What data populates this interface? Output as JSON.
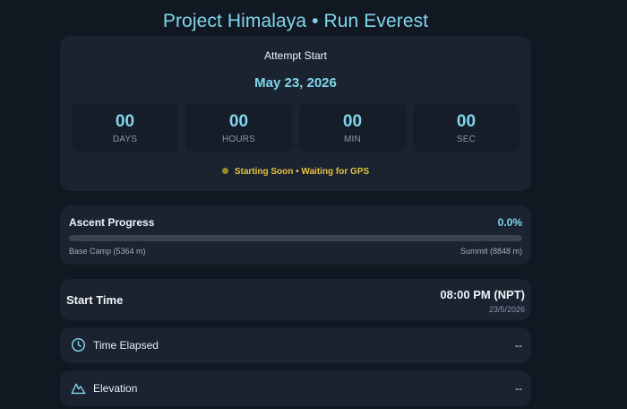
{
  "header": {
    "title": "Project Himalaya • Run Everest"
  },
  "countdown": {
    "label": "Attempt Start",
    "date": "May 23, 2026",
    "units": [
      {
        "value": "00",
        "label": "DAYS"
      },
      {
        "value": "00",
        "label": "HOURS"
      },
      {
        "value": "00",
        "label": "MIN"
      },
      {
        "value": "00",
        "label": "SEC"
      }
    ],
    "status": "Starting Soon • Waiting for GPS"
  },
  "progress": {
    "title": "Ascent Progress",
    "percent_text": "0.0%",
    "percent": 0.0,
    "start_label": "Base Camp (5364 m)",
    "end_label": "Summit (8848 m)"
  },
  "start_time": {
    "label": "Start Time",
    "time": "08:00 PM (NPT)",
    "date": "23/5/2026"
  },
  "stats": {
    "elapsed": {
      "label": "Time Elapsed",
      "value": "--",
      "icon": "clock-icon"
    },
    "elevation": {
      "label": "Elevation",
      "value": "--",
      "icon": "mountain-icon"
    }
  },
  "colors": {
    "background": "#121822",
    "card": "#1b2230",
    "accent": "#7fd6ec",
    "status": "#e5c13f"
  }
}
